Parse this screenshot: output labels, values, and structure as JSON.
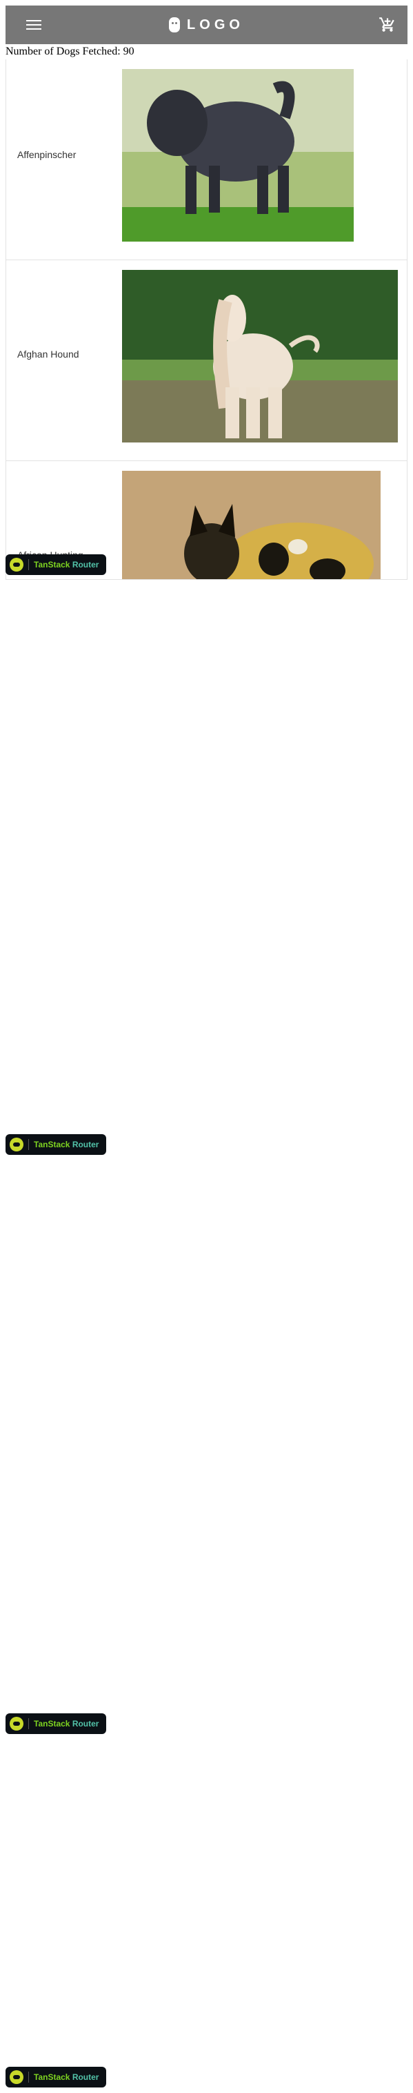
{
  "header": {
    "logo_text": "LOGO",
    "menu_icon": "menu-icon",
    "cart_icon": "cart-icon",
    "bg": "#777777"
  },
  "summary": {
    "text": "Number of Dogs Fetched: 90"
  },
  "dogs": [
    {
      "name": "Affenpinscher"
    },
    {
      "name": "Afghan Hound"
    },
    {
      "name": "African Hunting"
    }
  ],
  "devtools": {
    "label_a": "TanStack",
    "label_b": "Router"
  }
}
